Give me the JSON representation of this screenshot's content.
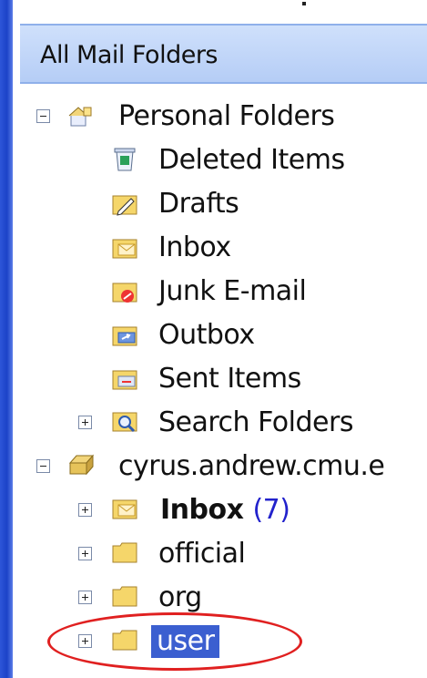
{
  "header": {
    "title": "All Mail Folders"
  },
  "tree": {
    "personal": {
      "label": "Personal Folders",
      "children": {
        "deleted": "Deleted Items",
        "drafts": "Drafts",
        "inbox": "Inbox",
        "junk": "Junk E-mail",
        "outbox": "Outbox",
        "sent": "Sent Items",
        "search": "Search Folders"
      }
    },
    "account": {
      "label": "cyrus.andrew.cmu.e",
      "children": {
        "inbox": "Inbox",
        "inbox_count": "(7)",
        "official": "official",
        "org": "org",
        "user": "user"
      }
    }
  },
  "colors": {
    "selection": "#3b5fd0",
    "highlight_circle": "#e02020",
    "unread_count": "#2222cc"
  }
}
